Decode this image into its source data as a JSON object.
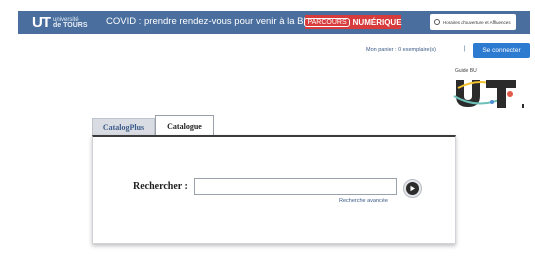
{
  "header": {
    "logo_text": "UT",
    "logo_sub_top": "université",
    "logo_sub_bottom": "de TOURS",
    "covid_text": "COVID : prendre rendez-vous pour venir à la BU",
    "parcours_box": "PARCOURS",
    "parcours_text": "NUMÉRIQUE",
    "horaires_text": "Horaires d'ouverture et Affluences",
    "bar_color": "#4a6f9e",
    "parcours_color": "#d73b3b"
  },
  "account": {
    "panier_text": "Mon panier : 0 exemplaire(s)",
    "separator": "|",
    "connect_label": "Se connecter",
    "connect_color": "#2d7ad1"
  },
  "guide": {
    "label": "Guide BU",
    "logo_letters": "UT"
  },
  "tabs": [
    {
      "label": "CatalogPlus",
      "active": false
    },
    {
      "label": "Catalogue",
      "active": true
    }
  ],
  "search": {
    "label": "Rechercher :",
    "value": "",
    "advanced_link": "Recherche avancée",
    "go_icon": "play-circle-icon"
  }
}
